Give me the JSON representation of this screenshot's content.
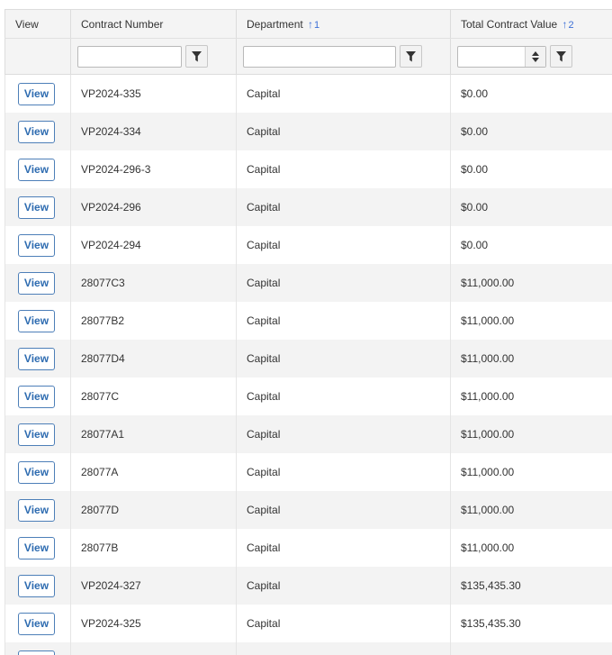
{
  "columns": {
    "view": "View",
    "contract_number": "Contract Number",
    "department": "Department",
    "department_sort_index": "1",
    "total_value": "Total Contract Value",
    "total_value_sort_index": "2"
  },
  "sort_arrow_glyph": "↑",
  "filters": {
    "contract_number_value": "",
    "department_value": "",
    "total_value_value": ""
  },
  "rows": [
    {
      "view": "View",
      "contract_number": "VP2024-335",
      "department": "Capital",
      "total_value": "$0.00"
    },
    {
      "view": "View",
      "contract_number": "VP2024-334",
      "department": "Capital",
      "total_value": "$0.00"
    },
    {
      "view": "View",
      "contract_number": "VP2024-296-3",
      "department": "Capital",
      "total_value": "$0.00"
    },
    {
      "view": "View",
      "contract_number": "VP2024-296",
      "department": "Capital",
      "total_value": "$0.00"
    },
    {
      "view": "View",
      "contract_number": "VP2024-294",
      "department": "Capital",
      "total_value": "$0.00"
    },
    {
      "view": "View",
      "contract_number": "28077C3",
      "department": "Capital",
      "total_value": "$11,000.00"
    },
    {
      "view": "View",
      "contract_number": "28077B2",
      "department": "Capital",
      "total_value": "$11,000.00"
    },
    {
      "view": "View",
      "contract_number": "28077D4",
      "department": "Capital",
      "total_value": "$11,000.00"
    },
    {
      "view": "View",
      "contract_number": "28077C",
      "department": "Capital",
      "total_value": "$11,000.00"
    },
    {
      "view": "View",
      "contract_number": "28077A1",
      "department": "Capital",
      "total_value": "$11,000.00"
    },
    {
      "view": "View",
      "contract_number": "28077A",
      "department": "Capital",
      "total_value": "$11,000.00"
    },
    {
      "view": "View",
      "contract_number": "28077D",
      "department": "Capital",
      "total_value": "$11,000.00"
    },
    {
      "view": "View",
      "contract_number": "28077B",
      "department": "Capital",
      "total_value": "$11,000.00"
    },
    {
      "view": "View",
      "contract_number": "VP2024-327",
      "department": "Capital",
      "total_value": "$135,435.30"
    },
    {
      "view": "View",
      "contract_number": "VP2024-325",
      "department": "Capital",
      "total_value": "$135,435.30"
    },
    {
      "view": "View",
      "contract_number": "",
      "department": "",
      "total_value": ""
    }
  ],
  "icons": {
    "filter": "filter-icon",
    "spinner": "spinner-icon"
  },
  "colors": {
    "accent": "#3c6fd6",
    "button_border": "#4d7fb8",
    "button_text": "#2d6bb0",
    "row_alt": "#f3f3f3",
    "header_bg": "#f4f4f4"
  }
}
